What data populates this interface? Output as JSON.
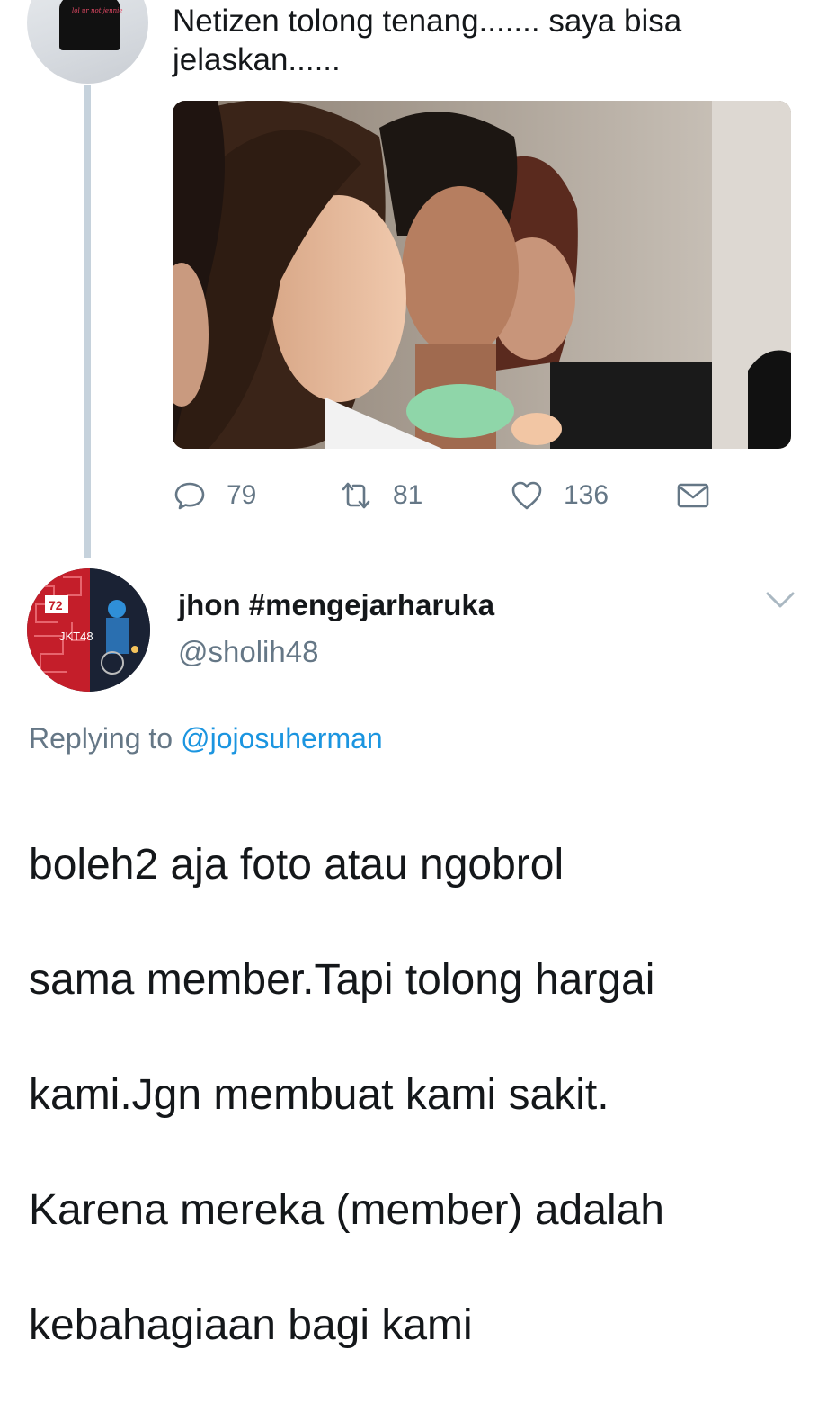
{
  "previous_tweet": {
    "avatar": {
      "shirt_print": "lol ur not jennie"
    },
    "text_lines": [
      "Netizen tolong tenang....... saya bisa",
      "jelaskan......"
    ],
    "actions": {
      "reply": {
        "icon": "reply-icon",
        "count": "79"
      },
      "retweet": {
        "icon": "retweet-icon",
        "count": "81"
      },
      "like": {
        "icon": "heart-icon",
        "count": "136"
      },
      "dm": {
        "icon": "envelope-icon"
      }
    }
  },
  "reply_tweet": {
    "avatar": {
      "badge_number": "72",
      "badge_text": "JKT48"
    },
    "display_name": "jhon #mengejarharuka",
    "handle": "@sholih48",
    "replying_to_label": "Replying to",
    "replying_to_mention": "@jojosuherman",
    "text_lines": [
      "boleh2 aja foto atau ngobrol",
      "sama member.Tapi tolong hargai",
      "kami.Jgn membuat kami sakit.",
      "Karena mereka (member) adalah",
      "kebahagiaan bagi kami"
    ]
  },
  "colors": {
    "text_primary": "#14171a",
    "text_secondary": "#657786",
    "link": "#1b95e0",
    "thread_line": "#c6d2dc"
  }
}
